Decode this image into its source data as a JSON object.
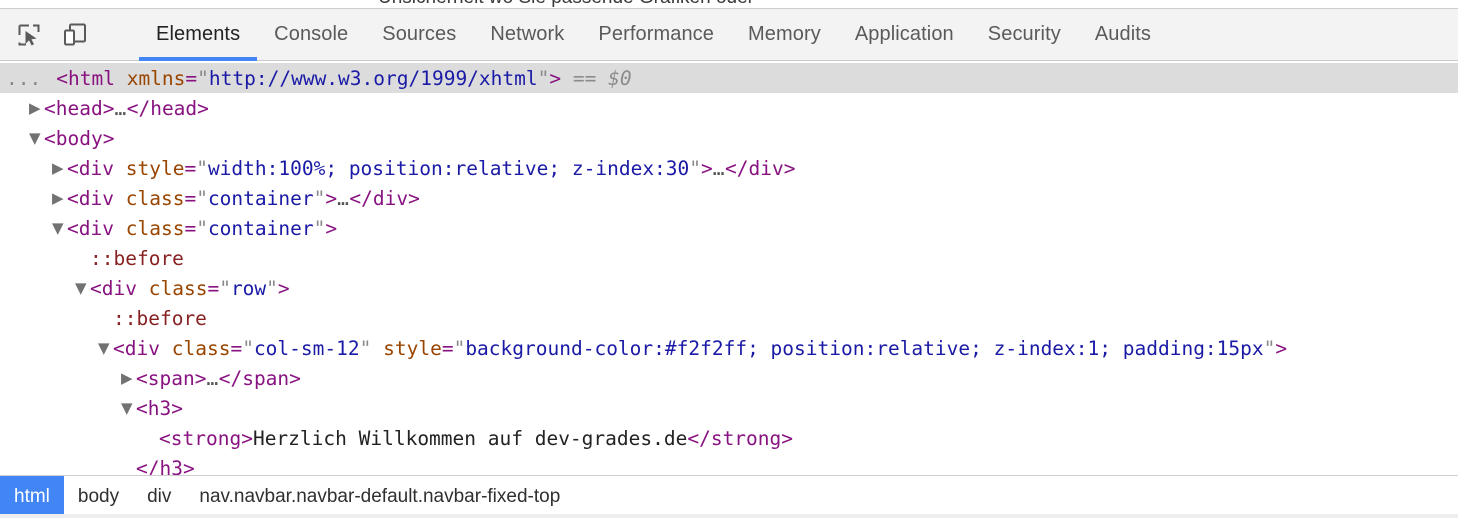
{
  "page_peek": {
    "clipped_text": "Unsicherheit wo Sie passende Grafiken oder"
  },
  "toolbar": {
    "inspect_icon": "inspect-element-icon",
    "device_icon": "device-toolbar-icon",
    "tabs": [
      {
        "label": "Elements",
        "active": true
      },
      {
        "label": "Console",
        "active": false
      },
      {
        "label": "Sources",
        "active": false
      },
      {
        "label": "Network",
        "active": false
      },
      {
        "label": "Performance",
        "active": false
      },
      {
        "label": "Memory",
        "active": false
      },
      {
        "label": "Application",
        "active": false
      },
      {
        "label": "Security",
        "active": false
      },
      {
        "label": "Audits",
        "active": false
      }
    ],
    "active_tab_color": "#4285f4"
  },
  "dom_tree": {
    "lines": [
      {
        "indent": 0,
        "twisty": "none",
        "selected": true,
        "leading_ellipsis": "...",
        "tokens": [
          {
            "t": "punct",
            "v": "<"
          },
          {
            "t": "tagname",
            "v": "html"
          },
          {
            "t": "space",
            "v": " "
          },
          {
            "t": "attrname",
            "v": "xmlns"
          },
          {
            "t": "punct2",
            "v": "="
          },
          {
            "t": "quote",
            "v": "\""
          },
          {
            "t": "attrval",
            "v": "http://www.w3.org/1999/xhtml"
          },
          {
            "t": "quote",
            "v": "\""
          },
          {
            "t": "punct",
            "v": ">"
          },
          {
            "t": "space",
            "v": " "
          },
          {
            "t": "eqeq",
            "v": "=="
          },
          {
            "t": "space",
            "v": " "
          },
          {
            "t": "dollar",
            "v": "$0"
          }
        ]
      },
      {
        "indent": 1,
        "twisty": "collapsed",
        "selected": false,
        "tokens": [
          {
            "t": "punct",
            "v": "<"
          },
          {
            "t": "tagname",
            "v": "head"
          },
          {
            "t": "punct",
            "v": ">"
          },
          {
            "t": "ellip",
            "v": "…"
          },
          {
            "t": "punct",
            "v": "</"
          },
          {
            "t": "tagname",
            "v": "head"
          },
          {
            "t": "punct",
            "v": ">"
          }
        ]
      },
      {
        "indent": 1,
        "twisty": "expanded",
        "selected": false,
        "tokens": [
          {
            "t": "punct",
            "v": "<"
          },
          {
            "t": "tagname",
            "v": "body"
          },
          {
            "t": "punct",
            "v": ">"
          }
        ]
      },
      {
        "indent": 2,
        "twisty": "collapsed",
        "selected": false,
        "tokens": [
          {
            "t": "punct",
            "v": "<"
          },
          {
            "t": "tagname",
            "v": "div"
          },
          {
            "t": "space",
            "v": " "
          },
          {
            "t": "attrname",
            "v": "style"
          },
          {
            "t": "punct2",
            "v": "="
          },
          {
            "t": "quote",
            "v": "\""
          },
          {
            "t": "attrval",
            "v": "width:100%; position:relative; z-index:30"
          },
          {
            "t": "quote",
            "v": "\""
          },
          {
            "t": "punct",
            "v": ">"
          },
          {
            "t": "ellip",
            "v": "…"
          },
          {
            "t": "punct",
            "v": "</"
          },
          {
            "t": "tagname",
            "v": "div"
          },
          {
            "t": "punct",
            "v": ">"
          }
        ]
      },
      {
        "indent": 2,
        "twisty": "collapsed",
        "selected": false,
        "tokens": [
          {
            "t": "punct",
            "v": "<"
          },
          {
            "t": "tagname",
            "v": "div"
          },
          {
            "t": "space",
            "v": " "
          },
          {
            "t": "attrname",
            "v": "class"
          },
          {
            "t": "punct2",
            "v": "="
          },
          {
            "t": "quote",
            "v": "\""
          },
          {
            "t": "attrval",
            "v": "container"
          },
          {
            "t": "quote",
            "v": "\""
          },
          {
            "t": "punct",
            "v": ">"
          },
          {
            "t": "ellip",
            "v": "…"
          },
          {
            "t": "punct",
            "v": "</"
          },
          {
            "t": "tagname",
            "v": "div"
          },
          {
            "t": "punct",
            "v": ">"
          }
        ]
      },
      {
        "indent": 2,
        "twisty": "expanded",
        "selected": false,
        "tokens": [
          {
            "t": "punct",
            "v": "<"
          },
          {
            "t": "tagname",
            "v": "div"
          },
          {
            "t": "space",
            "v": " "
          },
          {
            "t": "attrname",
            "v": "class"
          },
          {
            "t": "punct2",
            "v": "="
          },
          {
            "t": "quote",
            "v": "\""
          },
          {
            "t": "attrval",
            "v": "container"
          },
          {
            "t": "quote",
            "v": "\""
          },
          {
            "t": "punct",
            "v": ">"
          }
        ]
      },
      {
        "indent": 3,
        "twisty": "none",
        "selected": false,
        "tokens": [
          {
            "t": "pseudo",
            "v": "::before"
          }
        ]
      },
      {
        "indent": 3,
        "twisty": "expanded",
        "selected": false,
        "tokens": [
          {
            "t": "punct",
            "v": "<"
          },
          {
            "t": "tagname",
            "v": "div"
          },
          {
            "t": "space",
            "v": " "
          },
          {
            "t": "attrname",
            "v": "class"
          },
          {
            "t": "punct2",
            "v": "="
          },
          {
            "t": "quote",
            "v": "\""
          },
          {
            "t": "attrval",
            "v": "row"
          },
          {
            "t": "quote",
            "v": "\""
          },
          {
            "t": "punct",
            "v": ">"
          }
        ]
      },
      {
        "indent": 4,
        "twisty": "none",
        "selected": false,
        "tokens": [
          {
            "t": "pseudo",
            "v": "::before"
          }
        ]
      },
      {
        "indent": 4,
        "twisty": "expanded",
        "selected": false,
        "tokens": [
          {
            "t": "punct",
            "v": "<"
          },
          {
            "t": "tagname",
            "v": "div"
          },
          {
            "t": "space",
            "v": " "
          },
          {
            "t": "attrname",
            "v": "class"
          },
          {
            "t": "punct2",
            "v": "="
          },
          {
            "t": "quote",
            "v": "\""
          },
          {
            "t": "attrval",
            "v": "col-sm-12"
          },
          {
            "t": "quote",
            "v": "\""
          },
          {
            "t": "space",
            "v": " "
          },
          {
            "t": "attrname",
            "v": "style"
          },
          {
            "t": "punct2",
            "v": "="
          },
          {
            "t": "quote",
            "v": "\""
          },
          {
            "t": "attrval",
            "v": "background-color:#f2f2ff; position:relative; z-index:1; padding:15px"
          },
          {
            "t": "quote",
            "v": "\""
          },
          {
            "t": "punct",
            "v": ">"
          }
        ]
      },
      {
        "indent": 5,
        "twisty": "collapsed",
        "selected": false,
        "tokens": [
          {
            "t": "punct",
            "v": "<"
          },
          {
            "t": "tagname",
            "v": "span"
          },
          {
            "t": "punct",
            "v": ">"
          },
          {
            "t": "ellip",
            "v": "…"
          },
          {
            "t": "punct",
            "v": "</"
          },
          {
            "t": "tagname",
            "v": "span"
          },
          {
            "t": "punct",
            "v": ">"
          }
        ]
      },
      {
        "indent": 5,
        "twisty": "expanded",
        "selected": false,
        "tokens": [
          {
            "t": "punct",
            "v": "<"
          },
          {
            "t": "tagname",
            "v": "h3"
          },
          {
            "t": "punct",
            "v": ">"
          }
        ]
      },
      {
        "indent": 6,
        "twisty": "none",
        "selected": false,
        "tokens": [
          {
            "t": "punct",
            "v": "<"
          },
          {
            "t": "tagname",
            "v": "strong"
          },
          {
            "t": "punct",
            "v": ">"
          },
          {
            "t": "text",
            "v": "Herzlich Willkommen auf dev-grades.de"
          },
          {
            "t": "punct",
            "v": "</"
          },
          {
            "t": "tagname",
            "v": "strong"
          },
          {
            "t": "punct",
            "v": ">"
          }
        ]
      },
      {
        "indent": 5,
        "twisty": "none",
        "selected": false,
        "tokens": [
          {
            "t": "punct",
            "v": "</"
          },
          {
            "t": "tagname",
            "v": "h3"
          },
          {
            "t": "punct",
            "v": ">"
          }
        ]
      }
    ]
  },
  "breadcrumb": {
    "items": [
      {
        "label": "html",
        "active": true
      },
      {
        "label": "body",
        "active": false
      },
      {
        "label": "div",
        "active": false
      },
      {
        "label": "nav.navbar.navbar-default.navbar-fixed-top",
        "active": false
      }
    ],
    "active_color": "#4285f4"
  }
}
